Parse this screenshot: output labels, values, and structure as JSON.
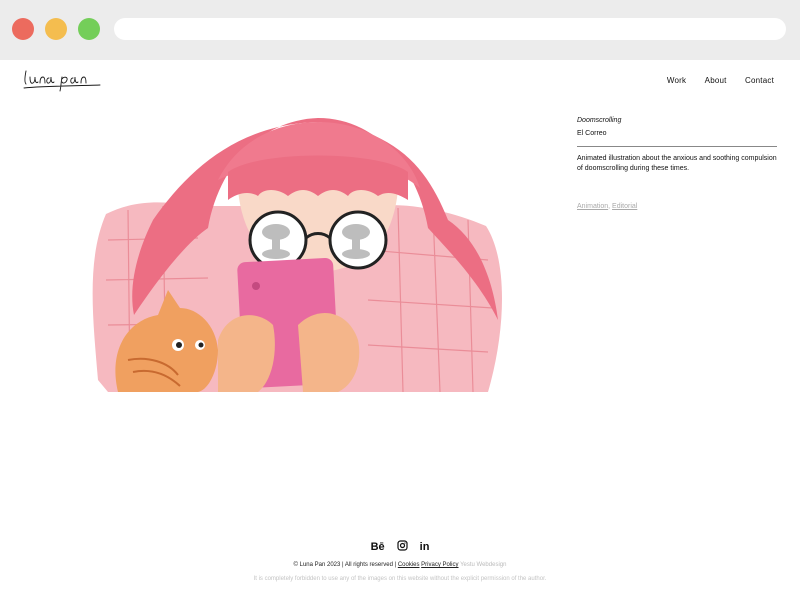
{
  "browser": {
    "traffic_lights": [
      "close",
      "minimize",
      "maximize"
    ],
    "colors": {
      "close": "#ec6b5e",
      "minimize": "#f4bd4f",
      "maximize": "#74ce59"
    }
  },
  "site": {
    "logo_text": "luna pan",
    "nav": [
      "Work",
      "About",
      "Contact"
    ]
  },
  "project": {
    "title": "Doomscrolling",
    "client": "El Correo",
    "description": "Animated illustration about the anxious and soothing compulsion of doomscrolling during these times.",
    "tags": [
      "Animation",
      "Editorial"
    ],
    "tag_sep": ", "
  },
  "footer": {
    "social": [
      "behance-icon",
      "instagram-icon",
      "linkedin-icon"
    ],
    "copyright": "© Luna Pan 2023 | All rights reserved |",
    "cookies": "Cookies",
    "privacy": "Privacy Policy",
    "credit": "Yestu Webdesign",
    "legal": "It is completely forbidden to use any of the images on this website without the explicit permission of the author."
  }
}
